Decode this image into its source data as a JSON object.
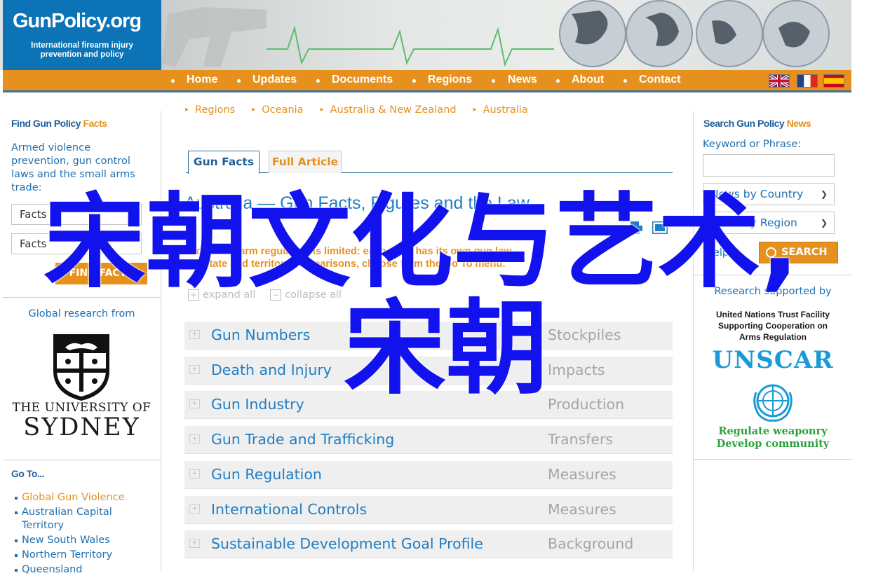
{
  "logo": {
    "title": "GunPolicy.org",
    "tagline_line1": "International firearm injury",
    "tagline_line2": "prevention and policy"
  },
  "nav": {
    "items": [
      "Home",
      "Updates",
      "Documents",
      "Regions",
      "News",
      "About",
      "Contact"
    ],
    "flags": [
      "uk-flag-icon",
      "france-flag-icon",
      "spain-flag-icon"
    ]
  },
  "left_sidebar": {
    "find_title_a": "Find Gun Policy",
    "find_title_b": "Facts",
    "description": "Armed violence prevention, gun control laws and the small arms trade:",
    "select1": "Facts",
    "select2": "Facts",
    "find_button": "FIND FACTS",
    "global_research": "Global research from",
    "university_line1": "THE UNIVERSITY OF",
    "university_line2": "SYDNEY",
    "goto_title": "Go To...",
    "goto_items": [
      "Global Gun Violence",
      "Australian Capital Territory",
      "New South Wales",
      "Northern Territory",
      "Queensland"
    ]
  },
  "main": {
    "breadcrumbs": [
      "Regions",
      "Oceania",
      "Australia & New Zealand",
      "Australia"
    ],
    "tab_active": "Gun Facts",
    "tab_inactive": "Full Article",
    "page_title": "Australia — Gun Facts, Figures and the Law",
    "intro_line1": "Federal firearm regulation is limited: each state has its own gun law.",
    "intro_line2": "For state and territory comparisons, choose from the Go To menu.",
    "expand_all": "expand all",
    "collapse_all": "collapse all",
    "expand_box": "+",
    "collapse_box": "−",
    "rows": [
      {
        "label": "Gun Numbers",
        "right": "Stockpiles"
      },
      {
        "label": "Death and Injury",
        "right": "Impacts"
      },
      {
        "label": "Gun Industry",
        "right": "Production"
      },
      {
        "label": "Gun Trade and Trafficking",
        "right": "Transfers"
      },
      {
        "label": "Gun Regulation",
        "right": "Measures"
      },
      {
        "label": "International Controls",
        "right": "Measures"
      },
      {
        "label": "Sustainable Development Goal Profile",
        "right": "Background"
      }
    ]
  },
  "right_sidebar": {
    "search_title_a": "Search Gun Policy",
    "search_title_b": "News",
    "keyword_label": "Keyword or Phrase:",
    "keyword_value": "",
    "select_country": "News by Country",
    "select_region": "News by Region",
    "help": "Help",
    "search_button": "SEARCH",
    "research_supported": "Research supported by",
    "untf_line1": "United Nations Trust Facility",
    "untf_line2": "Supporting Cooperation on",
    "untf_line3": "Arms Regulation",
    "unscar": "UNSCAR",
    "unscar_tag1": "Regulate weaponry",
    "unscar_tag2": "Develop community"
  },
  "watermark": {
    "line1": "宋朝文化与艺术,",
    "line2": "宋朝"
  },
  "colors": {
    "brand_blue": "#0b73b6",
    "nav_orange": "#e6911e",
    "link_blue": "#1f7ec5",
    "watermark_blue": "#1212ee"
  }
}
